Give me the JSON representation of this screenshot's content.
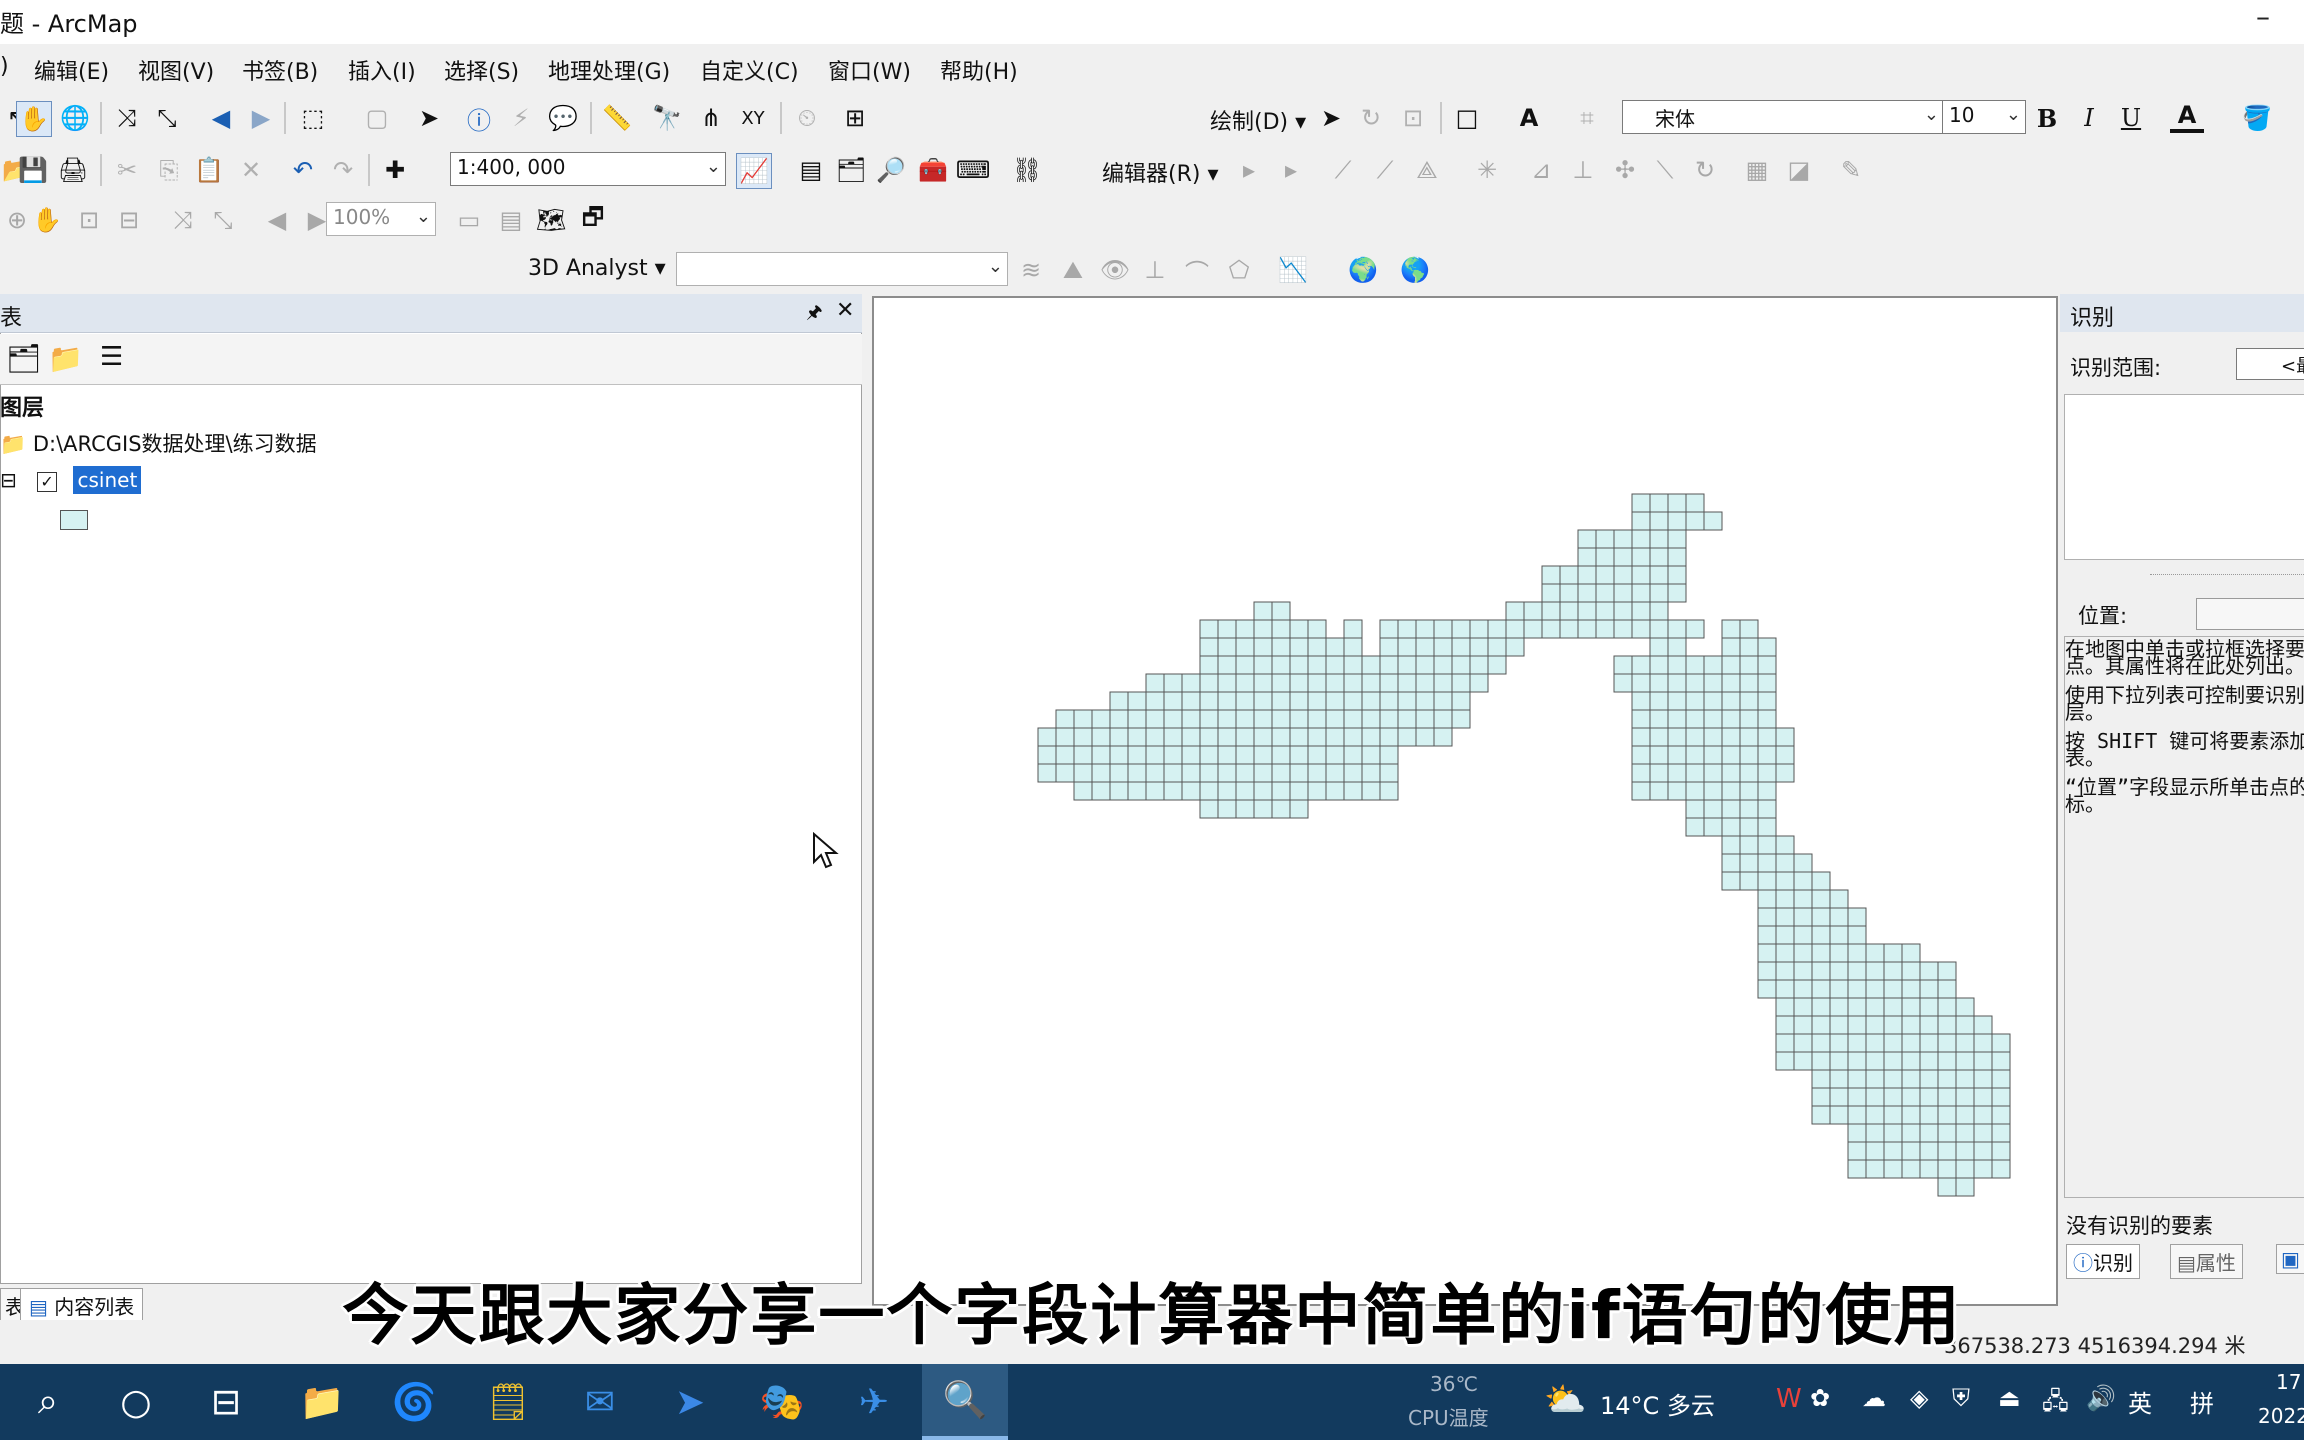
{
  "window": {
    "title": "题 - ArcMap",
    "minimize": "–"
  },
  "menu": [
    "编辑(E)",
    "视图(V)",
    "书签(B)",
    "插入(I)",
    "选择(S)",
    "地理处理(G)",
    "自定义(C)",
    "窗口(W)",
    "帮助(H)"
  ],
  "menu_first": ")",
  "toolbar2": {
    "draw_label": "绘制(D) ▾",
    "font_name": "宋体",
    "font_size": "10",
    "bold": "B",
    "italic": "I",
    "underline": "U",
    "font_color": "A"
  },
  "toolbar3": {
    "scale": "1:400, 000",
    "editor_label": "编辑器(R) ▾"
  },
  "toolbar4": {
    "zoom": "100%"
  },
  "toolbar5": {
    "analyst": "3D Analyst ▾"
  },
  "toc": {
    "title": "表",
    "pin": "📌",
    "close": "✕",
    "root": "图层",
    "folder": "D:\\ARCGIS数据处理\\练习数据",
    "layer": "csinet",
    "layer_checked": true,
    "expand": "⊟",
    "check_mark": "✓",
    "symbol_color": "#d6f2f2",
    "bottom_tab_left": "表",
    "bottom_tab": "内容列表"
  },
  "identify": {
    "title": "识别",
    "range_label": "识别范围:",
    "range_value": "<最",
    "location_label": "位置:",
    "help_1": "在地图中单击或拉框选择要素或地点。其属性将在此处列出。",
    "help_2": "使用下拉列表可控制要识别的图层。",
    "help_3": "按 SHIFT 键可将要素添加到列表。",
    "help_4": "“位置”字段显示所单击点的坐标。",
    "no_feature": "没有识别的要素",
    "tab_identify": "识别",
    "tab_attr": "属性"
  },
  "map": {
    "fill_color": "#d6f2f2",
    "stroke_color": "#555555"
  },
  "subtitle": "今天跟大家分享一个字段计算器中简单的if语句的使用",
  "status": {
    "coords": "367538.273  4516394.294 米"
  },
  "taskbar": {
    "cpu_temp": "36℃",
    "cpu_label": "CPU温度",
    "weather": "14°C  多云",
    "ime": "英",
    "ime2": "拼",
    "time": "17",
    "date": "2022"
  }
}
